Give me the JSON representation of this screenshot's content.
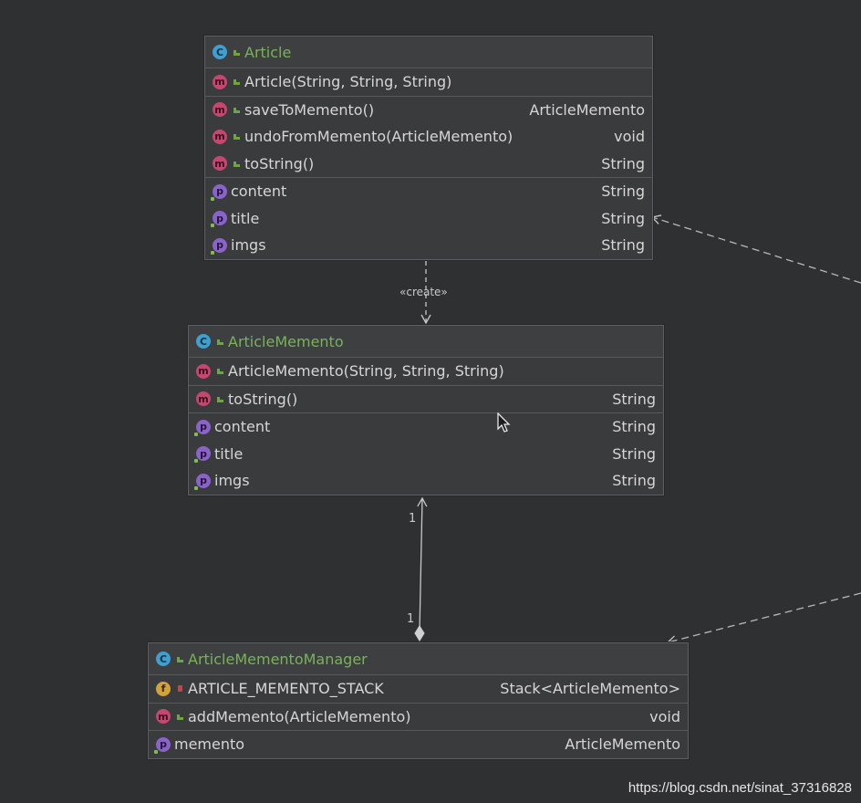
{
  "classes": {
    "article": {
      "name": "Article",
      "constructor": "Article(String, String, String)",
      "methods": [
        {
          "name": "saveToMemento()",
          "type": "ArticleMemento"
        },
        {
          "name": "undoFromMemento(ArticleMemento)",
          "type": "void"
        },
        {
          "name": "toString()",
          "type": "String"
        }
      ],
      "properties": [
        {
          "name": "content",
          "type": "String"
        },
        {
          "name": "title",
          "type": "String"
        },
        {
          "name": "imgs",
          "type": "String"
        }
      ]
    },
    "memento": {
      "name": "ArticleMemento",
      "constructor": "ArticleMemento(String, String, String)",
      "methods": [
        {
          "name": "toString()",
          "type": "String"
        }
      ],
      "properties": [
        {
          "name": "content",
          "type": "String"
        },
        {
          "name": "title",
          "type": "String"
        },
        {
          "name": "imgs",
          "type": "String"
        }
      ]
    },
    "manager": {
      "name": "ArticleMementoManager",
      "fields": [
        {
          "name": "ARTICLE_MEMENTO_STACK",
          "type": "Stack<ArticleMemento>"
        }
      ],
      "methods": [
        {
          "name": "addMemento(ArticleMemento)",
          "type": "void"
        }
      ],
      "properties": [
        {
          "name": "memento",
          "type": "ArticleMemento"
        }
      ]
    }
  },
  "links": {
    "create_label": "«create»",
    "mult_top": "1",
    "mult_bottom": "1"
  },
  "icons": {
    "class": "C",
    "method": "m",
    "property": "p",
    "field": "f"
  },
  "watermark": "https://blog.csdn.net/sinat_37316828",
  "colors": {
    "background": "#2f3032",
    "class_name": "#79b358",
    "class_icon": "#3e9fd0",
    "method_icon": "#c5476f",
    "property_icon": "#8a63c9",
    "field_icon": "#d1a23a"
  }
}
